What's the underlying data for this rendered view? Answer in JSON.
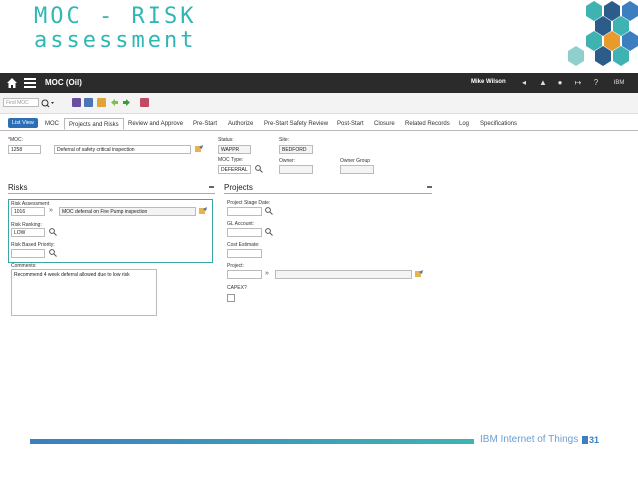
{
  "slide": {
    "title_line1": "MOC - RISK",
    "title_line2": "assessment"
  },
  "topbar": {
    "app_title": "MOC (Oil)",
    "user": "Mike Wilson"
  },
  "toolbar": {
    "find_placeholder": "Find MOC"
  },
  "tabs": {
    "list_view": "List View",
    "items": [
      "MOC",
      "Projects and Risks",
      "Review and Approve",
      "Pre-Start",
      "Authorize",
      "Pre-Start Safety Review",
      "Post-Start",
      "Closure",
      "Related Records",
      "Log",
      "Specifications"
    ],
    "active": "Projects and Risks"
  },
  "header": {
    "moc_label": "MOC:",
    "moc_value": "1258",
    "moc_desc": "Deferral of safety critical inspection",
    "status_label": "Status:",
    "status_value": "WAPPR",
    "site_label": "Site:",
    "site_value": "BEDFORD",
    "moc_type_label": "MOC Type:",
    "moc_type_value": "DEFERRAL",
    "owner_label": "Owner:",
    "owner_group_label": "Owner Group"
  },
  "risks": {
    "title": "Risks",
    "risk_assessment_label": "Risk Assessment",
    "risk_assessment_value": "1016",
    "risk_assessment_desc": "MOC deferral on Fire Pump inspection",
    "risk_ranking_label": "Risk Ranking:",
    "risk_ranking_value": "LOW",
    "risk_priority_label": "Risk Based Priority:",
    "comments_label": "Comments:",
    "comments_value": "Recommend 4 week deferral allowed due to low risk"
  },
  "projects": {
    "title": "Projects",
    "stage_date_label": "Project Stage Date:",
    "gl_account_label": "GL Account:",
    "cost_estimate_label": "Cost Estimate:",
    "project_label": "Project:",
    "capex_label": "CAPEX?"
  },
  "footer": {
    "brand": "IBM Internet of Things",
    "page": "31"
  },
  "colors": {
    "teal": "#2fb7b5",
    "blue": "#3b7fc1",
    "dark_bar": "#2b2b2b"
  }
}
